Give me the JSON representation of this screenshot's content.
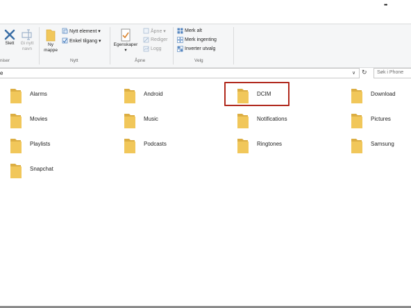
{
  "window": {
    "controls": "••"
  },
  "ribbon": {
    "organize": {
      "delete_label": "Slett",
      "rename_label": "Gi nytt\nnavn",
      "group_label": "niser"
    },
    "new": {
      "new_folder_label": "Ny\nmappe",
      "new_item_label": "Nytt element ▾",
      "easy_access_label": "Enkel tilgang ▾",
      "group_label": "Nytt"
    },
    "open": {
      "properties_label": "Egenskaper",
      "properties_arrow": "▾",
      "open_label": "Åpne ▾",
      "edit_label": "Rediger",
      "history_label": "Logg",
      "group_label": "Åpne"
    },
    "select": {
      "select_all_label": "Merk alt",
      "select_none_label": "Merk ingenting",
      "invert_label": "Inverter utvalg",
      "group_label": "Velg"
    }
  },
  "address": {
    "path": "e",
    "dropdown": "∨",
    "refresh": "↻",
    "search_placeholder": "Søk i Phone"
  },
  "folders": [
    {
      "name": "Alarms"
    },
    {
      "name": "Android"
    },
    {
      "name": "DCIM"
    },
    {
      "name": "Download"
    },
    {
      "name": "Movies"
    },
    {
      "name": "Music"
    },
    {
      "name": "Notifications"
    },
    {
      "name": "Pictures"
    },
    {
      "name": "Playlists"
    },
    {
      "name": "Podcasts"
    },
    {
      "name": "Ringtones"
    },
    {
      "name": "Samsung"
    },
    {
      "name": "Snapchat"
    }
  ],
  "highlighted_folder": "DCIM",
  "colors": {
    "highlight": "#b0281c",
    "folder": "#f1c75a",
    "folder_dark": "#dcae43"
  }
}
